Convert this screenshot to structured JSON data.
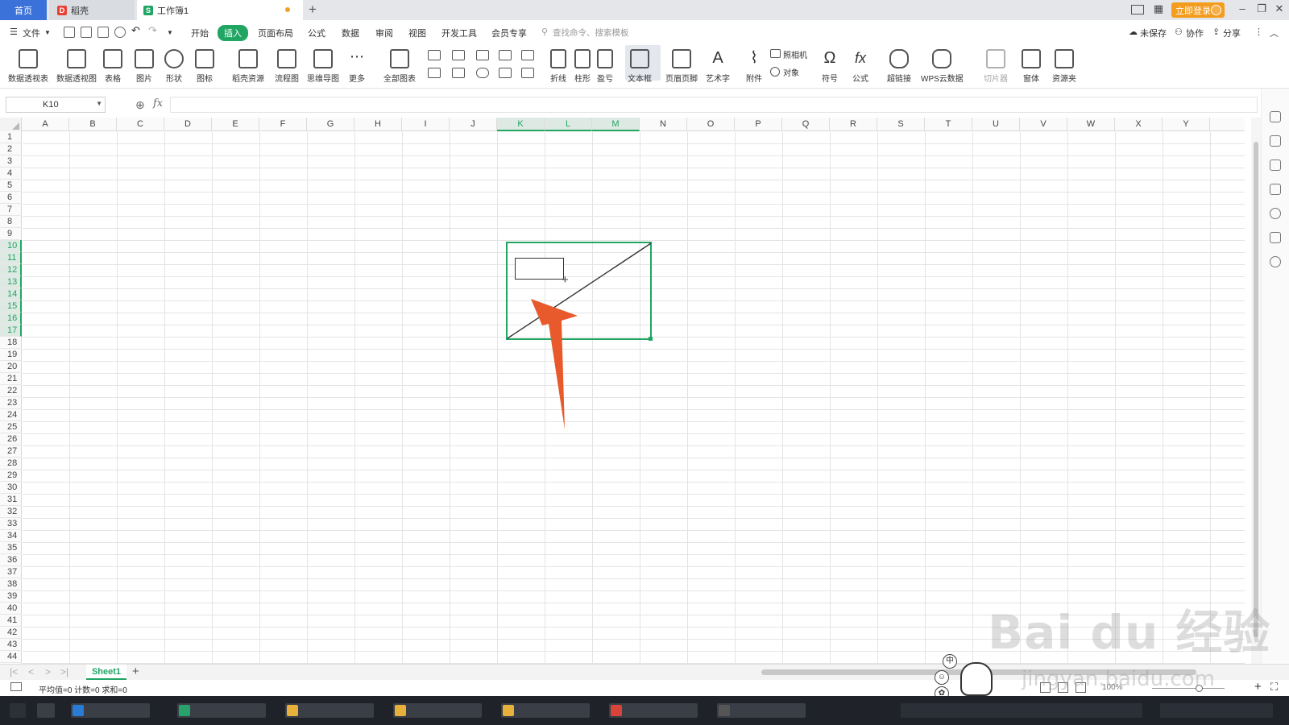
{
  "titlebar": {
    "tabs": [
      {
        "label": "首页"
      },
      {
        "label": "稻壳"
      },
      {
        "label": "工作簿1"
      }
    ],
    "login_label": "立即登录"
  },
  "menubar": {
    "file_label": "文件",
    "items": [
      "开始",
      "插入",
      "页面布局",
      "公式",
      "数据",
      "审阅",
      "视图",
      "开发工具",
      "会员专享"
    ],
    "active_item": "插入",
    "search_placeholder": "查找命令、搜索模板",
    "right_items": [
      "未保存",
      "协作",
      "分享"
    ]
  },
  "ribbon": {
    "buttons": [
      "数据透视表",
      "数据透视图",
      "表格",
      "图片",
      "形状",
      "图标",
      "稻壳资源",
      "流程图",
      "思维导图",
      "更多",
      "全部图表",
      "折线",
      "柱形",
      "盈亏",
      "文本框",
      "页眉页脚",
      "艺术字",
      "附件",
      "符号",
      "公式",
      "超链接",
      "WPS云数据",
      "切片器",
      "窗体",
      "资源夹"
    ],
    "small_buttons": [
      "照相机",
      "对象"
    ]
  },
  "formula_bar": {
    "name_box": "K10",
    "fx_label": "fx",
    "value": ""
  },
  "grid": {
    "columns": [
      "A",
      "B",
      "C",
      "D",
      "E",
      "F",
      "G",
      "H",
      "I",
      "J",
      "K",
      "L",
      "M",
      "N",
      "O",
      "P",
      "Q",
      "R",
      "S",
      "T",
      "U",
      "V",
      "W",
      "X",
      "Y"
    ],
    "selected_columns": [
      "K",
      "L",
      "M"
    ],
    "rows": [
      "1",
      "2",
      "3",
      "4",
      "5",
      "6",
      "7",
      "8",
      "9",
      "10",
      "11",
      "12",
      "13",
      "14",
      "15",
      "16",
      "17",
      "18",
      "19",
      "20",
      "21",
      "22",
      "23",
      "24",
      "25",
      "26",
      "27",
      "28",
      "29",
      "30",
      "31",
      "32",
      "33",
      "34",
      "35",
      "36",
      "37",
      "38",
      "39",
      "40",
      "41",
      "42",
      "43",
      "44"
    ],
    "selected_rows": [
      "10",
      "11",
      "12",
      "13",
      "14",
      "15",
      "16",
      "17"
    ]
  },
  "sheetbar": {
    "sheets": [
      "Sheet1"
    ],
    "active_sheet": "Sheet1"
  },
  "statusbar": {
    "text": "平均值=0  计数=0  求和=0",
    "zoom": "100%"
  },
  "watermark": {
    "main": "Bai du 经验",
    "sub": "jingyan.baidu.com",
    "ime_label": "中"
  },
  "colors": {
    "accent": "#20a563",
    "tab_home": "#3b72d9",
    "login": "#f39c1e",
    "arrow": "#e85a2c"
  }
}
